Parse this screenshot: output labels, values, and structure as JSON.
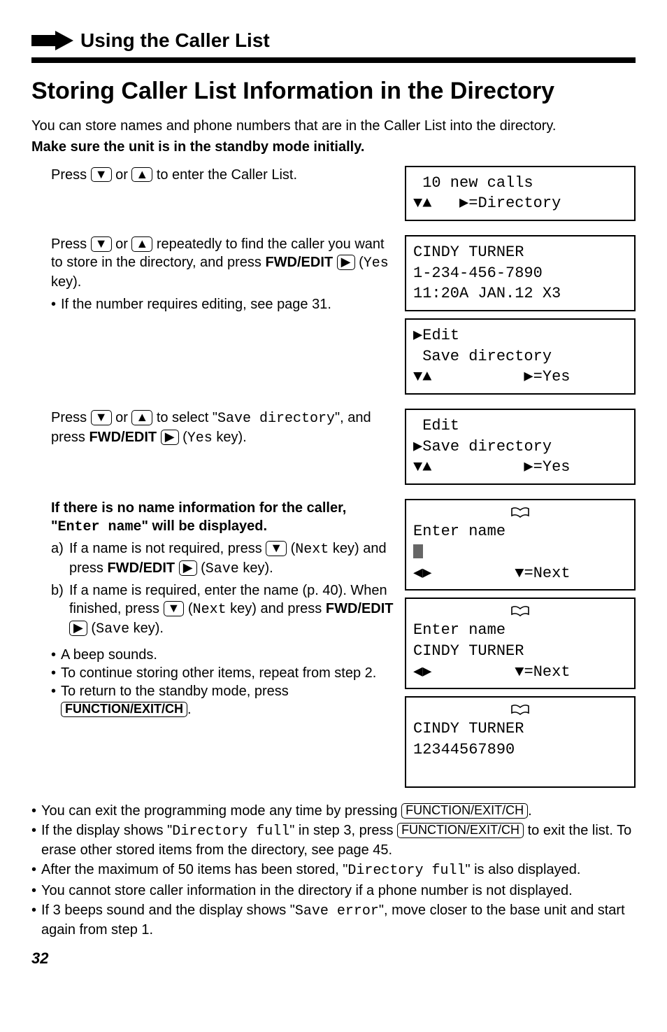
{
  "header": {
    "section_title": "Using the Caller List"
  },
  "title": "Storing Caller List Information in the Directory",
  "intro_line1": "You can store names and phone numbers that are in the Caller List into the directory.",
  "intro_line2": "Make sure the unit is in the standby mode initially.",
  "steps": {
    "s1": {
      "text_a": "Press ",
      "text_b": " or ",
      "text_c": " to enter the Caller List.",
      "lcd": " 10 new calls\n▼▲   ▶=Directory"
    },
    "s2": {
      "text_a": "Press ",
      "text_b": " or ",
      "text_c": " repeatedly to find the caller you want to store in the directory, and press ",
      "fwd_label": "FWD/EDIT",
      "text_d": " (",
      "yes": "Yes",
      "text_e": " key).",
      "bullet": "If the number requires editing, see page 31.",
      "lcd1": "CINDY TURNER\n1-234-456-7890\n11:20A JAN.12 X3",
      "lcd2": "▶Edit\n Save directory\n▼▲          ▶=Yes"
    },
    "s3": {
      "text_a": "Press ",
      "text_b": " or ",
      "text_c": " to select \"",
      "save_dir": "Save directory",
      "text_d": "\", and press ",
      "fwd_label": "FWD/EDIT",
      "text_e": " (",
      "yes": "Yes",
      "text_f": " key).",
      "lcd": " Edit\n▶Save directory\n▼▲          ▶=Yes"
    },
    "s4": {
      "heading_a": "If there is no name information for the caller, \"",
      "enter_name": "Enter name",
      "heading_b": "\" will be displayed.",
      "a_text1": "If a name is not required, press ",
      "a_text2": " (",
      "next": "Next",
      "a_text3": " key) and press ",
      "fwd_label": "FWD/EDIT",
      "a_text4": " (",
      "save": "Save",
      "a_text5": " key).",
      "b_text1": "If a name is required, enter the name (p. 40). When finished, press ",
      "b_text2": " (",
      "b_text3": " key) and press ",
      "b_text4": " (",
      "b_text5": " key).",
      "bul1": "A beep sounds.",
      "bul2": "To continue storing other items, repeat from step 2.",
      "bul3": "To return to the standby mode, press ",
      "func_ch": "FUNCTION/EXIT/CH",
      "bul3_end": ".",
      "lcd1_line1_center_is_book": true,
      "lcd1_line2": "Enter name",
      "lcd1_line4": "◀▶         ▼=Next",
      "lcd2_line2": "Enter name",
      "lcd2_line3": "CINDY TURNER",
      "lcd2_line4": "◀▶         ▼=Next",
      "lcd3_line2": "CINDY TURNER",
      "lcd3_line3": "12344567890"
    }
  },
  "keys": {
    "down": "▼",
    "up": "▲",
    "right": "▶"
  },
  "notes": {
    "n1a": "You can exit the programming mode any time by pressing ",
    "n1b": ".",
    "n2a": "If the display shows \"",
    "n2_dir_full": "Directory full",
    "n2b": "\" in step 3, press ",
    "n2c": " to exit the list. To erase other stored items from the directory, see page 45.",
    "n3a": "After the maximum of 50 items has been stored, \"",
    "n3b": "\" is also displayed.",
    "n4": "You cannot store caller information in the directory if a phone number is not displayed.",
    "n5a": "If 3 beeps sound and the display shows \"",
    "n5_save_err": "Save error",
    "n5b": "\", move closer to the base unit and start again from step 1."
  },
  "page_number": "32"
}
